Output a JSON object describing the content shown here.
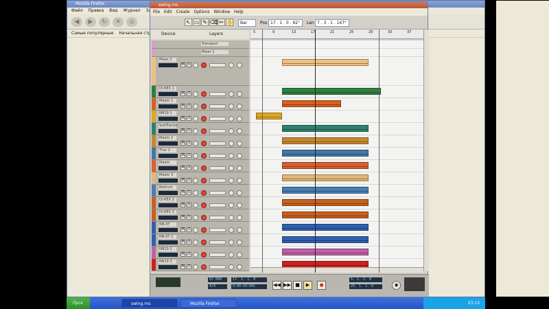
{
  "firefox": {
    "title": "Mozilla Firefox",
    "menu": [
      "Файл",
      "Правка",
      "Вид",
      "Журнал",
      "Закл"
    ],
    "bookmarks": [
      "Самые популярные",
      "Начальная стр"
    ]
  },
  "reaper": {
    "title": "swing.rns",
    "menu": [
      "File",
      "Edit",
      "Create",
      "Options",
      "Window",
      "Help"
    ],
    "toolbar": {
      "grid_value": "Bar",
      "pos_label": "Pos",
      "pos_value": "17 . 1 . 0 . 92\"",
      "len_label": "Len",
      "len_value": "7 . 3 . 1 . 147\""
    },
    "tabs": [
      "Device",
      "Layers"
    ],
    "ruler_marks": [
      "5",
      "9",
      "13",
      "17",
      "21",
      "25",
      "29",
      "33",
      "37"
    ],
    "tracks": [
      {
        "name": "Transport",
        "color": "#d8a0c0",
        "h": 12
      },
      {
        "name": "Mixer 1",
        "color": "#d8a0c0",
        "h": 12
      },
      {
        "name": "Mixer 2",
        "color": "#f0c080",
        "h": 42
      },
      {
        "name": "Dr.REX 1",
        "color": "#2f8040",
        "h": 18
      },
      {
        "name": "Malstr 1",
        "color": "#d86020",
        "h": 18
      },
      {
        "name": "NN19 1",
        "color": "#e0a820",
        "h": 18
      },
      {
        "name": "SubTractor",
        "color": "#2f8070",
        "h": 18
      },
      {
        "name": "Malstr 2",
        "color": "#c88830",
        "h": 18
      },
      {
        "name": "Thor 1",
        "color": "#4478a8",
        "h": 18
      },
      {
        "name": "Malstr",
        "color": "#d86030",
        "h": 18
      },
      {
        "name": "Malstr 3",
        "color": "#e0b878",
        "h": 18
      },
      {
        "name": "Redrum",
        "color": "#4880b0",
        "h": 18
      },
      {
        "name": "Dr.REX 2",
        "color": "#c86020",
        "h": 18
      },
      {
        "name": "Dr.REX 3",
        "color": "#c86020",
        "h": 18
      },
      {
        "name": "NN-XT",
        "color": "#3060b0",
        "h": 18
      },
      {
        "name": "NN-XT 2",
        "color": "#3060b0",
        "h": 18
      },
      {
        "name": "NN19 2",
        "color": "#c060a8",
        "h": 18
      },
      {
        "name": "NN19 3",
        "color": "#d02020",
        "h": 18
      }
    ],
    "transport": {
      "tempo": "97.000",
      "signature": "4/4",
      "position": "17. 1. 1. 0",
      "time": "0:00:43:001",
      "left_loc": "5. 1. 1. 0",
      "right_loc": "25. 1. 1. 0"
    }
  },
  "taskbar": {
    "start": "Пуск",
    "tasks": [
      "swing.rns",
      "Mozilla Firefox"
    ],
    "clock": "23:13"
  }
}
